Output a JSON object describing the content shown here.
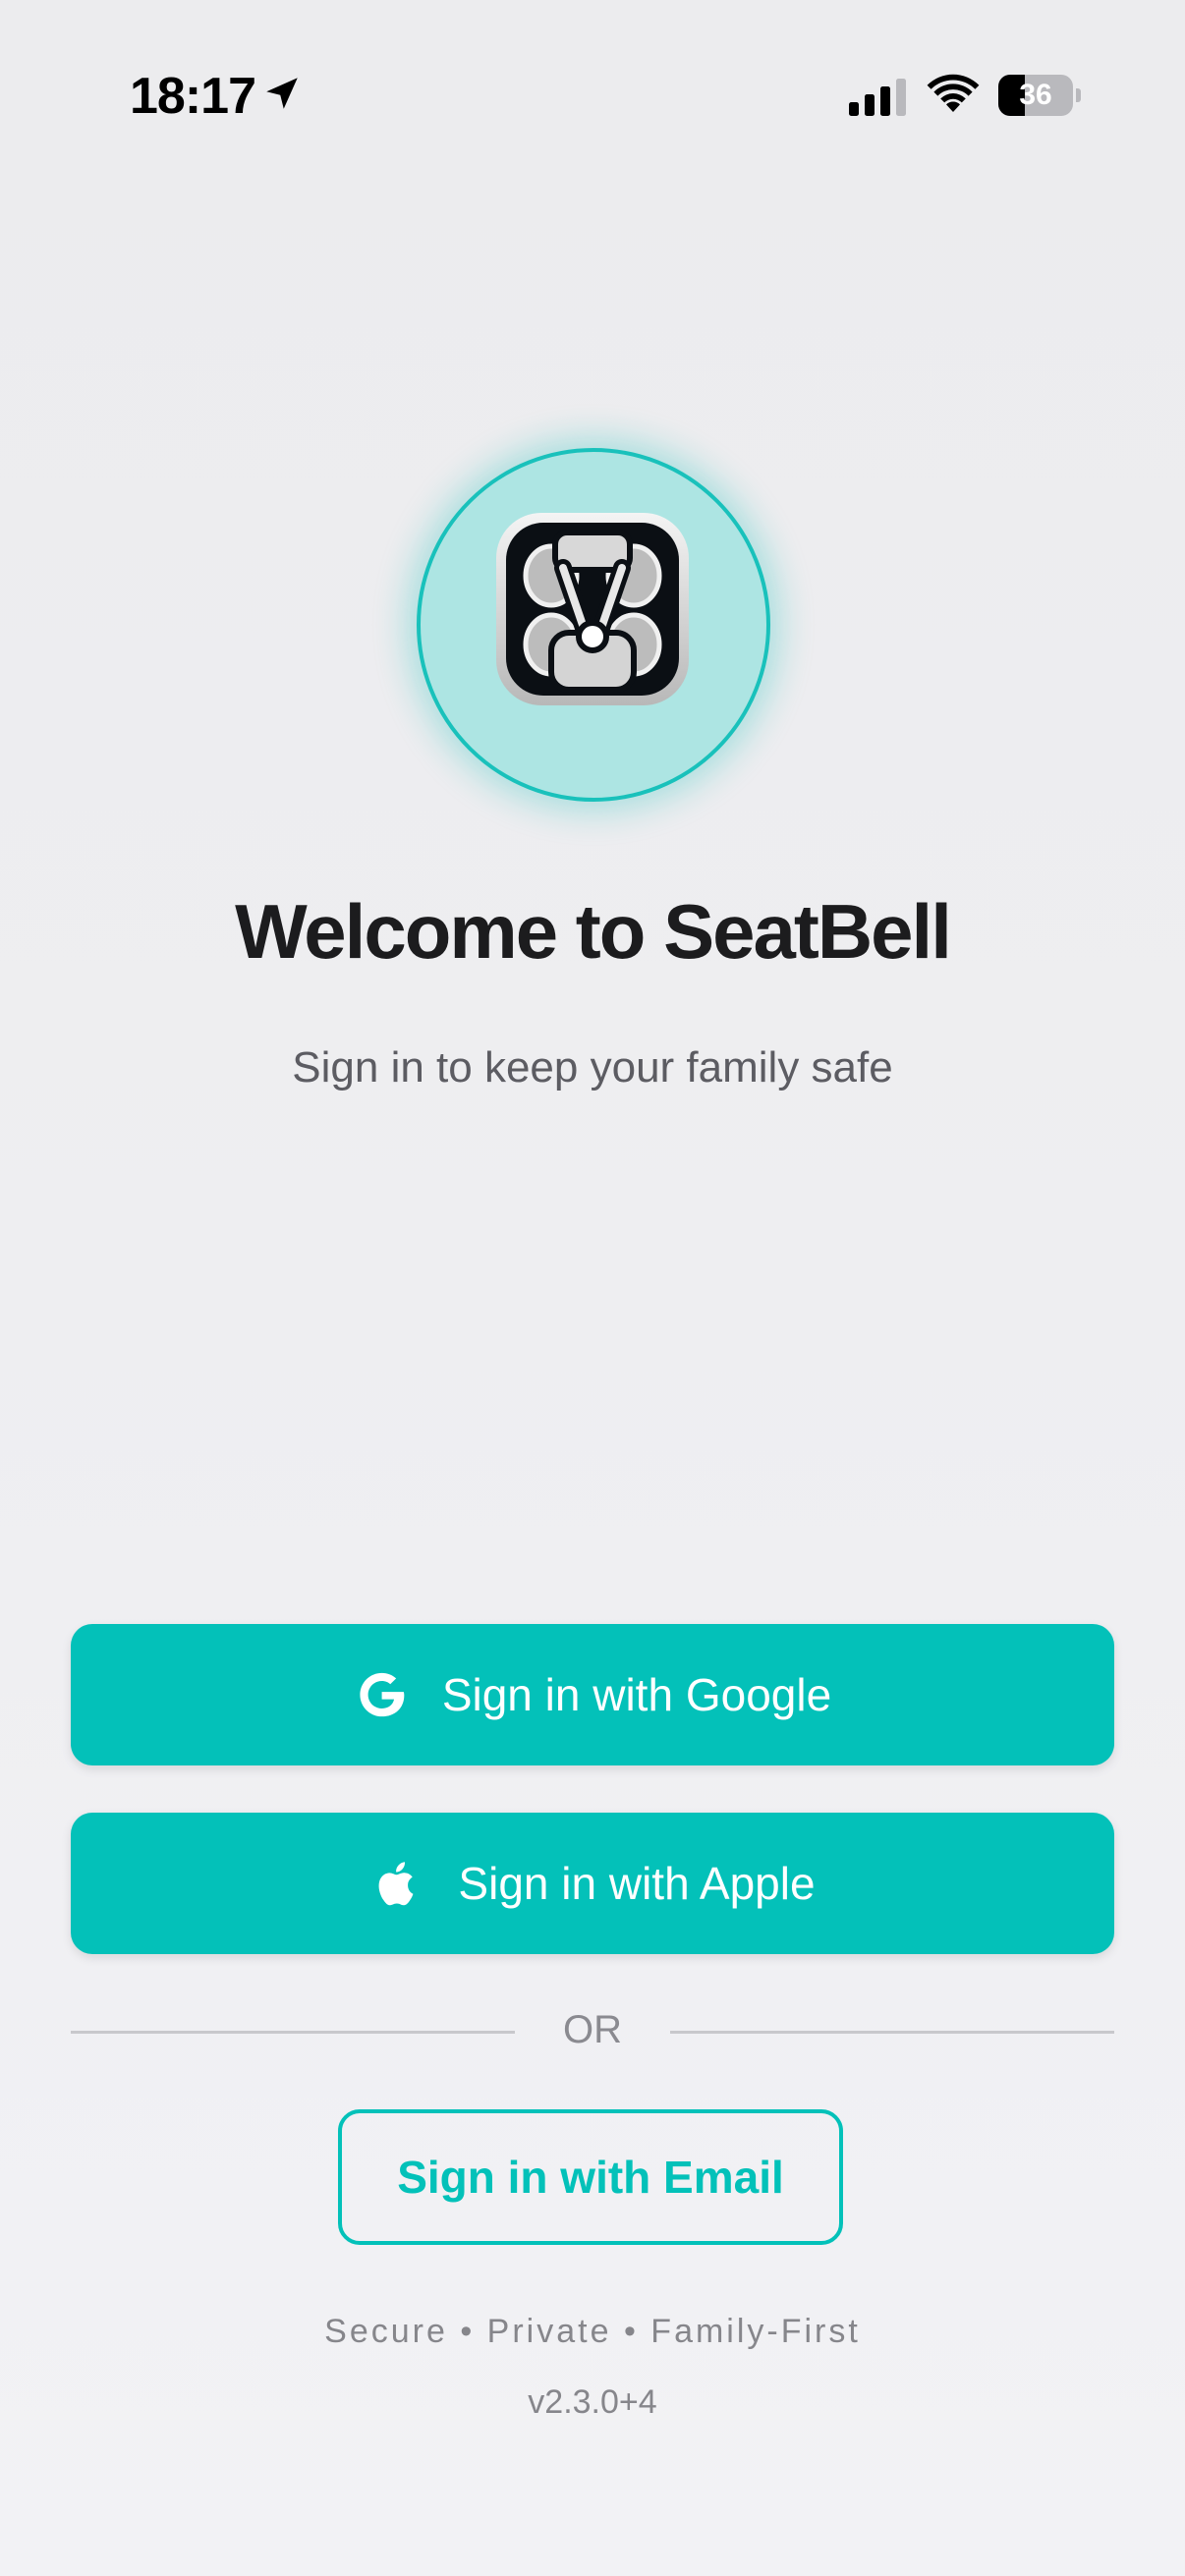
{
  "status_bar": {
    "time": "18:17",
    "battery_level": "36",
    "battery_fraction": 0.36,
    "icons": [
      "location-arrow-icon",
      "cellular-signal-icon",
      "wifi-icon",
      "battery-icon"
    ]
  },
  "app": {
    "logo_icon": "car-seat-icon",
    "title": "Welcome to SeatBell",
    "subtitle": "Sign in to keep your family safe"
  },
  "auth": {
    "google_label": "Sign in with Google",
    "google_icon": "google-icon",
    "apple_label": "Sign in with Apple",
    "apple_icon": "apple-icon",
    "divider_text": "OR",
    "email_label": "Sign in with Email"
  },
  "footer": {
    "tagline": "Secure • Private • Family-First",
    "version": "v2.3.0+4"
  },
  "colors": {
    "accent": "#03c1b9",
    "logo_ring_fill": "#ade5e3",
    "title": "#1c1c1e",
    "muted": "#86868b"
  }
}
